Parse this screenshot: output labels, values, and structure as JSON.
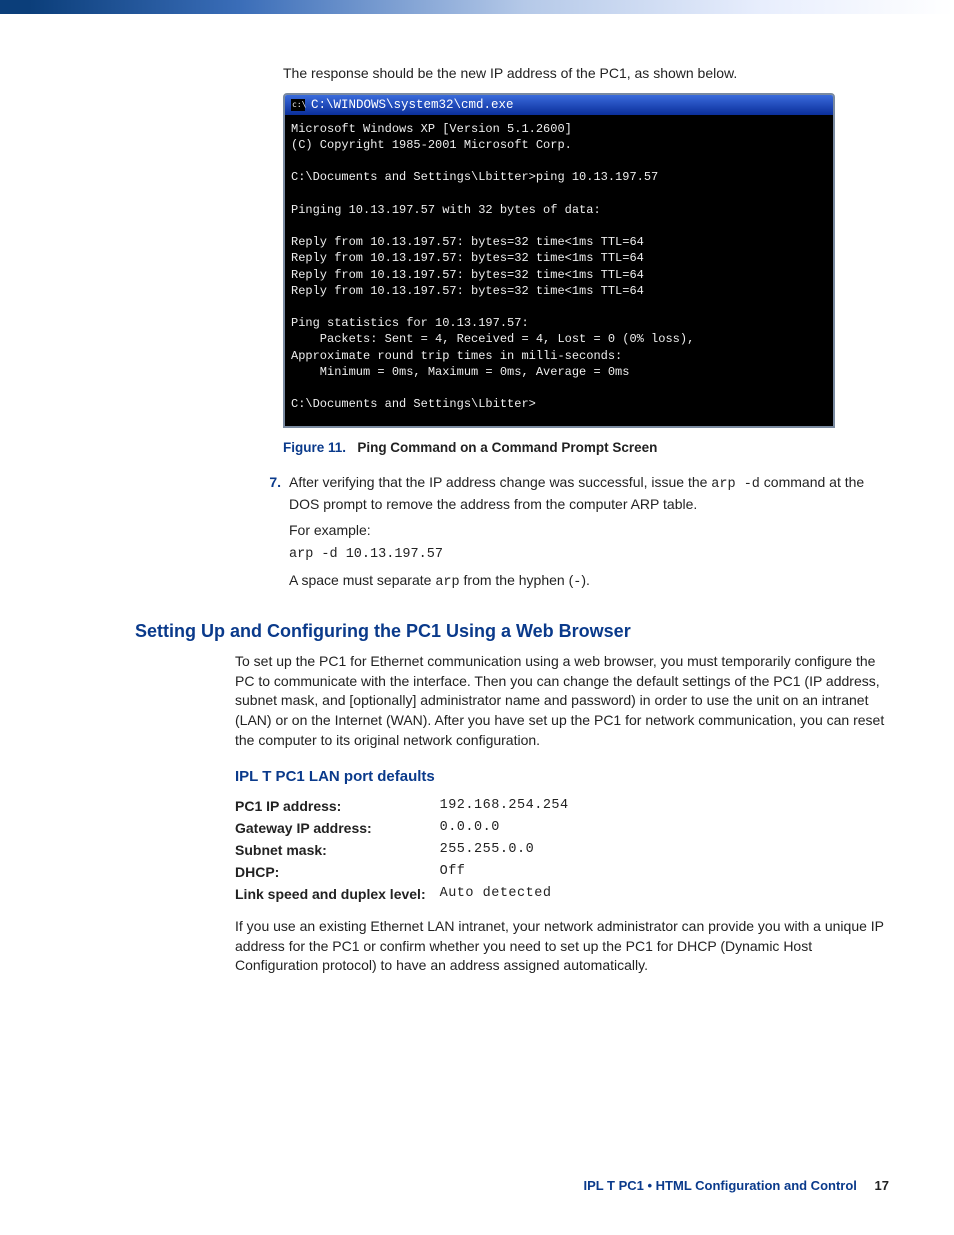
{
  "intro_text": "The response should be the new IP address of the PC1, as shown below.",
  "cmd": {
    "title": "C:\\WINDOWS\\system32\\cmd.exe",
    "icon_label": "c:\\",
    "lines": "Microsoft Windows XP [Version 5.1.2600]\n(C) Copyright 1985-2001 Microsoft Corp.\n\nC:\\Documents and Settings\\Lbitter>ping 10.13.197.57\n\nPinging 10.13.197.57 with 32 bytes of data:\n\nReply from 10.13.197.57: bytes=32 time<1ms TTL=64\nReply from 10.13.197.57: bytes=32 time<1ms TTL=64\nReply from 10.13.197.57: bytes=32 time<1ms TTL=64\nReply from 10.13.197.57: bytes=32 time<1ms TTL=64\n\nPing statistics for 10.13.197.57:\n    Packets: Sent = 4, Received = 4, Lost = 0 (0% loss),\nApproximate round trip times in milli-seconds:\n    Minimum = 0ms, Maximum = 0ms, Average = 0ms\n\nC:\\Documents and Settings\\Lbitter>"
  },
  "figure": {
    "num": "Figure 11.",
    "caption": "Ping Command on a Command Prompt Screen"
  },
  "step7": {
    "num": "7.",
    "text_a": "After verifying that the IP address change was successful, issue the ",
    "cmd_inline": "arp -d",
    "text_b": " command at the DOS prompt to remove the address from the computer ARP table.",
    "example_label": "For example:",
    "example_cmd": "arp -d 10.13.197.57",
    "note_a": "A space must separate ",
    "note_code": "arp",
    "note_b": " from the hyphen (",
    "note_hyphen": "-",
    "note_c": ")."
  },
  "section_heading": "Setting Up and Configuring the PC1 Using a Web Browser",
  "section_body": "To set up the PC1 for Ethernet communication using a web browser, you must temporarily configure the PC to communicate with the interface. Then you can change the default settings of the PC1 (IP address, subnet mask, and [optionally] administrator name and password) in order to use the unit on an intranet (LAN) or on the Internet (WAN). After you have set up the PC1 for network communication, you can reset the computer to its original network configuration.",
  "subsection_heading": "IPL T PC1 LAN port defaults",
  "defaults": [
    {
      "label": "PC1 IP address:",
      "value": "192.168.254.254"
    },
    {
      "label": "Gateway IP address:",
      "value": "0.0.0.0"
    },
    {
      "label": "Subnet mask:",
      "value": "255.255.0.0"
    },
    {
      "label": "DHCP:",
      "value": "Off"
    },
    {
      "label": "Link speed and duplex level:",
      "value": "Auto detected"
    }
  ],
  "closing_para": "If you use an existing Ethernet LAN intranet, your network administrator can provide you with a unique IP address for the PC1 or confirm whether you need to set up the PC1 for DHCP (Dynamic Host Configuration protocol) to have an address assigned automatically.",
  "footer": {
    "title": "IPL T PC1 • HTML Configuration and Control",
    "page": "17"
  }
}
